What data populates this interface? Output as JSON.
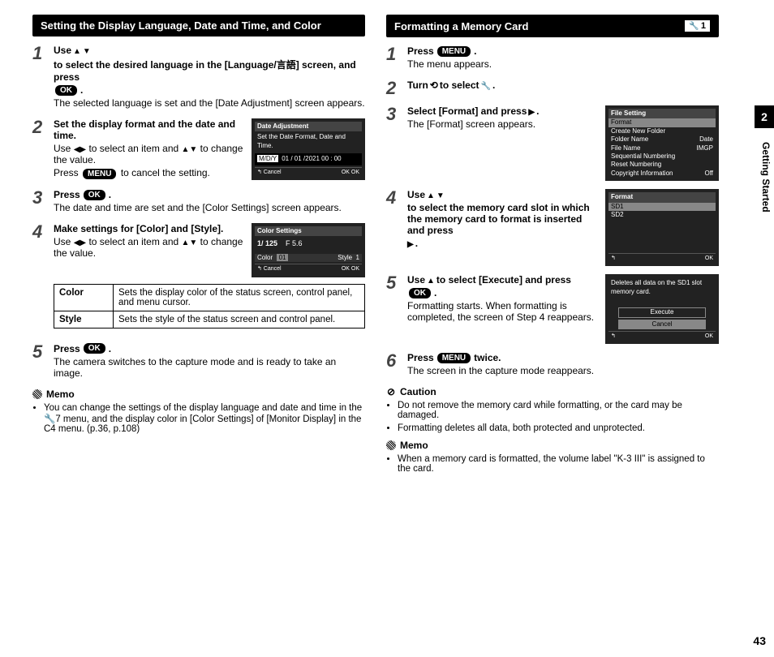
{
  "sideTabNumber": "2",
  "sideLabel": "Getting Started",
  "pageNumber": "43",
  "left": {
    "header": "Setting the Display Language, Date and Time, and Color",
    "steps": [
      {
        "num": "1",
        "titlePre": "Use ",
        "titlePost": " to select the desired language in the [Language/言語] screen, and press ",
        "titleEnd": ".",
        "desc": "The selected language is set and the [Date Adjustment] screen appears."
      },
      {
        "num": "2",
        "title": "Set the display format and the date and time.",
        "descLine1Pre": "Use ",
        "descLine1Post": " to select an item and ",
        "descLine1Post2": " to change the value.",
        "descLine2Pre": "Press ",
        "descLine2Post": " to cancel the setting.",
        "screen": {
          "title": "Date Adjustment",
          "sub": "Set the Date Format, Date and Time.",
          "row": "M/D/Y   01 / 01 /2021   00 : 00",
          "footerLeft": "↰ Cancel",
          "footerRight": "OK OK"
        }
      },
      {
        "num": "3",
        "titlePre": "Press ",
        "titlePost": ".",
        "desc": "The date and time are set and the [Color Settings] screen appears."
      },
      {
        "num": "4",
        "title": "Make settings for [Color] and [Style].",
        "descLine1Pre": "Use ",
        "descLine1Post": " to select an item and ",
        "descLine1Post2": " to change the value.",
        "screen": {
          "title": "Color Settings",
          "shutter": "1/ 125",
          "fnum": "F 5.6",
          "rowL1": "Color",
          "rowL2": "01",
          "rowR1": "Style",
          "rowR2": "1",
          "footerLeft": "↰ Cancel",
          "footerRight": "OK OK"
        }
      },
      {
        "num": "5",
        "titlePre": "Press ",
        "titlePost": ".",
        "desc": "The camera switches to the capture mode and is ready to take an image."
      }
    ],
    "table": [
      {
        "k": "Color",
        "v": "Sets the display color of the status screen, control panel, and menu cursor."
      },
      {
        "k": "Style",
        "v": "Sets the style of the status screen and control panel."
      }
    ],
    "memoTitle": "Memo",
    "memoNote": "You can change the settings of the display language and date and time in the 🔧7 menu, and the display color in [Color Settings] of [Monitor Display] in the C4 menu. (p.36, p.108)"
  },
  "right": {
    "header": "Formatting a Memory Card",
    "badgeNum": "1",
    "steps": [
      {
        "num": "1",
        "titlePre": "Press ",
        "titlePost": ".",
        "desc": "The menu appears."
      },
      {
        "num": "2",
        "titlePre": "Turn ",
        "titleMid": " to select ",
        "titlePost": "."
      },
      {
        "num": "3",
        "titlePre": "Select [Format] and press ",
        "titlePost": ".",
        "desc": "The [Format] screen appears.",
        "screen": {
          "title": "File Setting",
          "rows": [
            "Format",
            "Create New Folder",
            "Folder Name             Date",
            "File Name               IMGP",
            "Sequential Numbering",
            "Reset Numbering",
            "Copyright Information    Off"
          ]
        }
      },
      {
        "num": "4",
        "titlePre": "Use ",
        "titlePost": " to select the memory card slot in which the memory card to format is inserted and press ",
        "titleEnd": ".",
        "screen": {
          "title": "Format",
          "rows": [
            "SD1",
            "SD2"
          ]
        }
      },
      {
        "num": "5",
        "titlePre": "Use ",
        "titleMid": " to select [Execute] and press ",
        "titlePost": ".",
        "desc": "Formatting starts. When formatting is completed, the screen of Step 4 reappears.",
        "screen": {
          "sub": "Deletes all data on the SD1 slot memory card.",
          "rows": [
            "Execute",
            "Cancel"
          ]
        }
      },
      {
        "num": "6",
        "titlePre": "Press ",
        "titlePost": " twice.",
        "desc": "The screen in the capture mode reappears."
      }
    ],
    "cautionTitle": "Caution",
    "cautionNotes": [
      "Do not remove the memory card while formatting, or the card may be damaged.",
      "Formatting deletes all data, both protected and unprotected."
    ],
    "memoTitle": "Memo",
    "memoNote": "When a memory card is formatted, the volume label \"K-3 III\" is assigned to the card."
  },
  "buttons": {
    "ok": "OK",
    "menu": "MENU"
  }
}
